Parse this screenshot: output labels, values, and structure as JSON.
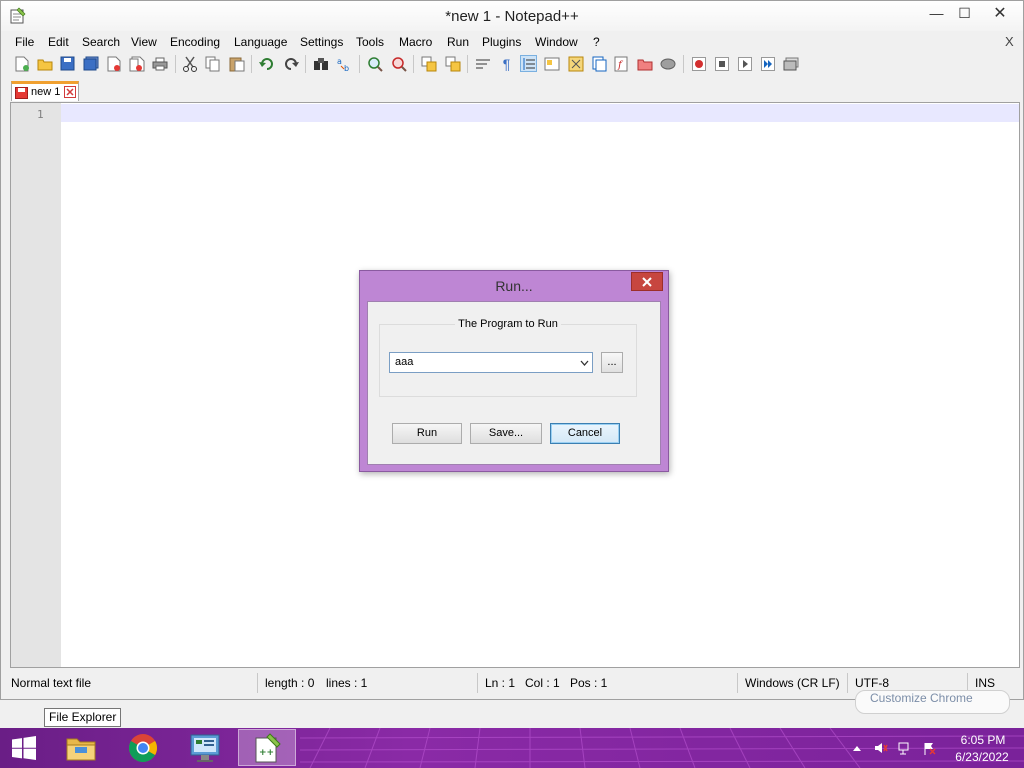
{
  "window": {
    "title": "*new 1 - Notepad++",
    "controls": {
      "minimize": "—",
      "maximize": "☐",
      "close": "✕"
    }
  },
  "menu": {
    "items": [
      "File",
      "Edit",
      "Search",
      "View",
      "Encoding",
      "Language",
      "Settings",
      "Tools",
      "Macro",
      "Run",
      "Plugins",
      "Window",
      "?"
    ],
    "close_doc": "X"
  },
  "tabs": [
    {
      "label": "new 1",
      "modified": true
    }
  ],
  "editor": {
    "line_number": "1"
  },
  "status": {
    "file_type": "Normal text file",
    "length": "length : 0",
    "lines": "lines : 1",
    "ln": "Ln : 1",
    "col": "Col : 1",
    "pos": "Pos : 1",
    "eol": "Windows (CR LF)",
    "encoding": "UTF-8",
    "mode": "INS"
  },
  "dialog": {
    "title": "Run...",
    "group_label": "The Program to Run",
    "program_value": "aaa",
    "browse_label": "...",
    "run_label": "Run",
    "save_label": "Save...",
    "cancel_label": "Cancel"
  },
  "tooltip": {
    "text": "File Explorer"
  },
  "notification": {
    "text": "Customize Chrome"
  },
  "taskbar": {
    "apps": [
      "start",
      "file-explorer",
      "chrome",
      "control-panel",
      "notepad-plus-plus"
    ],
    "time": "6:05 PM",
    "date": "6/23/2022"
  },
  "colors": {
    "dialog_frame": "#be86d4",
    "dialog_close": "#c7463f",
    "taskbar": "#7a229a",
    "tab_accent": "#f0a030",
    "current_line": "#e8e8ff"
  }
}
